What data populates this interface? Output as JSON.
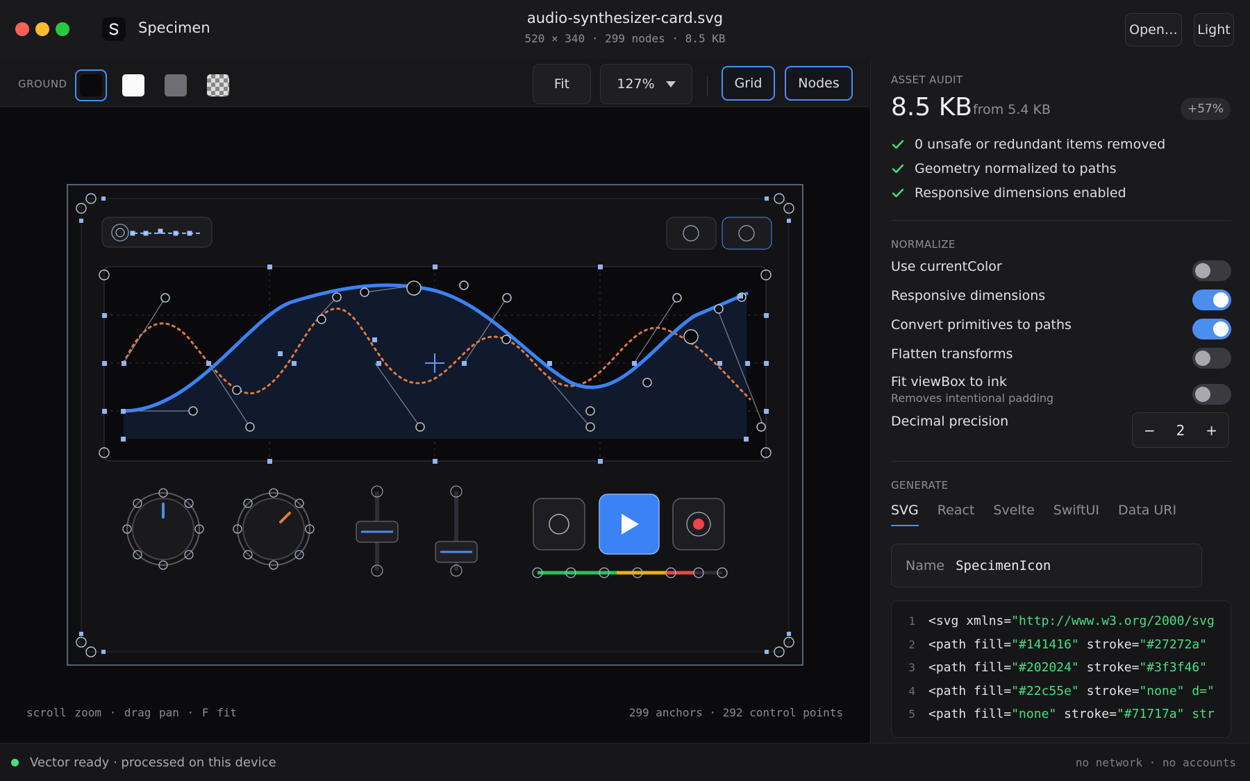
{
  "window": {
    "app_name": "Specimen",
    "file_name": "audio-synthesizer-card.svg",
    "file_meta": "520 × 340 · 299 nodes · 8.5 KB",
    "open_label": "Open…",
    "theme_label": "Light"
  },
  "toolbar": {
    "ground_label": "GROUND",
    "swatches": [
      "dark",
      "white",
      "gray",
      "checker"
    ],
    "selected_swatch": "dark",
    "fit_label": "Fit",
    "zoom_value": "127%",
    "grid_label": "Grid",
    "nodes_label": "Nodes"
  },
  "canvas": {
    "hint": "scroll zoom · drag pan · F fit",
    "counts": "299 anchors · 292 control points"
  },
  "audit": {
    "section": "ASSET AUDIT",
    "size": "8.5 KB",
    "from": "from 5.4 KB",
    "delta": "+57%",
    "checks": [
      "0 unsafe or redundant items removed",
      "Geometry normalized to paths",
      "Responsive dimensions enabled"
    ]
  },
  "normalize": {
    "section": "NORMALIZE",
    "options": [
      {
        "label": "Use currentColor",
        "on": false
      },
      {
        "label": "Responsive dimensions",
        "on": true
      },
      {
        "label": "Convert primitives to paths",
        "on": true
      },
      {
        "label": "Flatten transforms",
        "on": false
      },
      {
        "label": "Fit viewBox to ink",
        "sub": "Removes intentional padding",
        "on": false
      }
    ],
    "precision_label": "Decimal precision",
    "precision_value": "2",
    "minus": "−",
    "plus": "+"
  },
  "generate": {
    "section": "GENERATE",
    "tabs": [
      "SVG",
      "React",
      "Svelte",
      "SwiftUI",
      "Data URI"
    ],
    "active_tab": "SVG",
    "name_label": "Name",
    "name_value": "SpecimenIcon",
    "code_lines": [
      {
        "n": "1",
        "tag": "<svg",
        "attr1": " xmlns=",
        "val1": "\"http://www.w3.org/2000/svg",
        "attr2": "",
        "val2": ""
      },
      {
        "n": "2",
        "tag": "<path",
        "attr1": " fill=",
        "val1": "\"#141416\"",
        "attr2": " stroke=",
        "val2": "\"#27272a\""
      },
      {
        "n": "3",
        "tag": "<path",
        "attr1": " fill=",
        "val1": "\"#202024\"",
        "attr2": " stroke=",
        "val2": "\"#3f3f46\""
      },
      {
        "n": "4",
        "tag": "<path",
        "attr1": " fill=",
        "val1": "\"#22c55e\"",
        "attr2": " stroke=",
        "val2": "\"none\" d=\""
      },
      {
        "n": "5",
        "tag": "<path",
        "attr1": " fill=",
        "val1": "\"none\"",
        "attr2": " stroke=",
        "val2": "\"#71717a\" str"
      }
    ]
  },
  "status": {
    "left": "Vector ready · processed on this device",
    "right": "no network · no accounts"
  },
  "colors": {
    "accent": "#4a8ef0",
    "success": "#4ade80",
    "wave": "#3b82f6",
    "dotted": "#e07a40",
    "record": "#ef4444"
  }
}
